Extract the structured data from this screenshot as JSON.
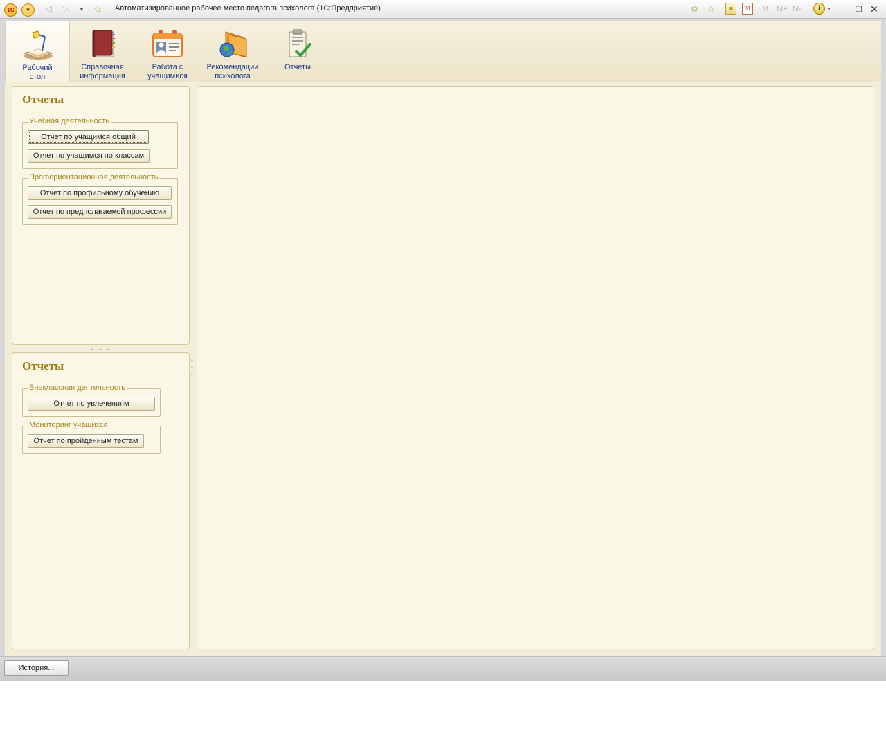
{
  "window": {
    "title": "Автоматизированное рабочее место педагога психолога  (1С:Предприятие)",
    "logo_text": "1С",
    "calendar_day": "31",
    "memory_buttons": [
      "M",
      "M+",
      "M-"
    ],
    "info_glyph": "i"
  },
  "sections": [
    {
      "label": "Рабочий стол",
      "icon": "desk-lamp-icon",
      "active": true
    },
    {
      "label": "Справочная информация",
      "icon": "book-icon",
      "active": false
    },
    {
      "label": "Работа с учащимися",
      "icon": "contact-card-icon",
      "active": false
    },
    {
      "label": "Рекомендации психолога",
      "icon": "folder-globe-icon",
      "active": false
    },
    {
      "label": "Отчеты",
      "icon": "clipboard-check-icon",
      "active": false
    }
  ],
  "panel_top": {
    "title": "Отчеты",
    "group1": {
      "legend": "Учебная деятельность",
      "buttons": [
        "Отчет по учащимся общий",
        "Отчет по учащимся по классам"
      ]
    },
    "group2": {
      "legend": "Профориентационная деятельность",
      "buttons": [
        "Отчет по профильному обучению",
        "Отчет по предполагаемой профессии"
      ]
    }
  },
  "panel_bottom": {
    "title": "Отчеты",
    "group1": {
      "legend": "Внеклассная деятельность",
      "buttons": [
        "Отчет по увлечениям"
      ]
    },
    "group2": {
      "legend": "Мониторинг учащихся",
      "buttons": [
        "Отчет по пройденным тестам"
      ]
    }
  },
  "bottombar": {
    "history_label": "История..."
  },
  "colors": {
    "accent_title": "#9b7b12",
    "section_label": "#1f3a8c",
    "panel_bg": "#fbf7e7"
  }
}
